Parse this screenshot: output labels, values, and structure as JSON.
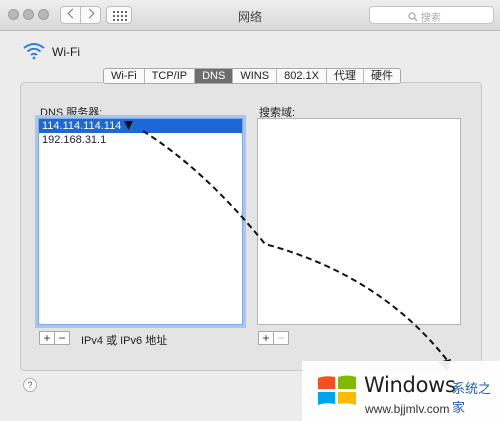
{
  "window": {
    "title": "网络"
  },
  "search": {
    "placeholder": "搜索",
    "icon": "search-icon"
  },
  "interface": {
    "name": "Wi-Fi",
    "icon": "wifi-icon"
  },
  "tabs": [
    {
      "label": "Wi-Fi",
      "active": false
    },
    {
      "label": "TCP/IP",
      "active": false
    },
    {
      "label": "DNS",
      "active": true
    },
    {
      "label": "WINS",
      "active": false
    },
    {
      "label": "802.1X",
      "active": false
    },
    {
      "label": "代理",
      "active": false
    },
    {
      "label": "硬件",
      "active": false
    }
  ],
  "dns": {
    "label": "DNS 服务器:",
    "servers": [
      "114.114.114.114",
      "192.168.31.1"
    ],
    "selected_index": 0,
    "hint": "IPv4 或 IPv6 地址"
  },
  "search_domains": {
    "label": "搜索域:",
    "items": []
  },
  "buttons": {
    "add": "+",
    "remove": "−",
    "help": "?"
  },
  "watermark": {
    "brand": "Windows",
    "tagline": "系统之家",
    "url": "www.bjjmlv.com",
    "colors": {
      "red": "#f25022",
      "green": "#7fba00",
      "blue": "#00a4ef",
      "yellow": "#ffb900"
    }
  },
  "colors": {
    "selection": "#1e68d6",
    "tab_active": "#6e6e6e",
    "focus_ring": "#a9c6ef"
  }
}
